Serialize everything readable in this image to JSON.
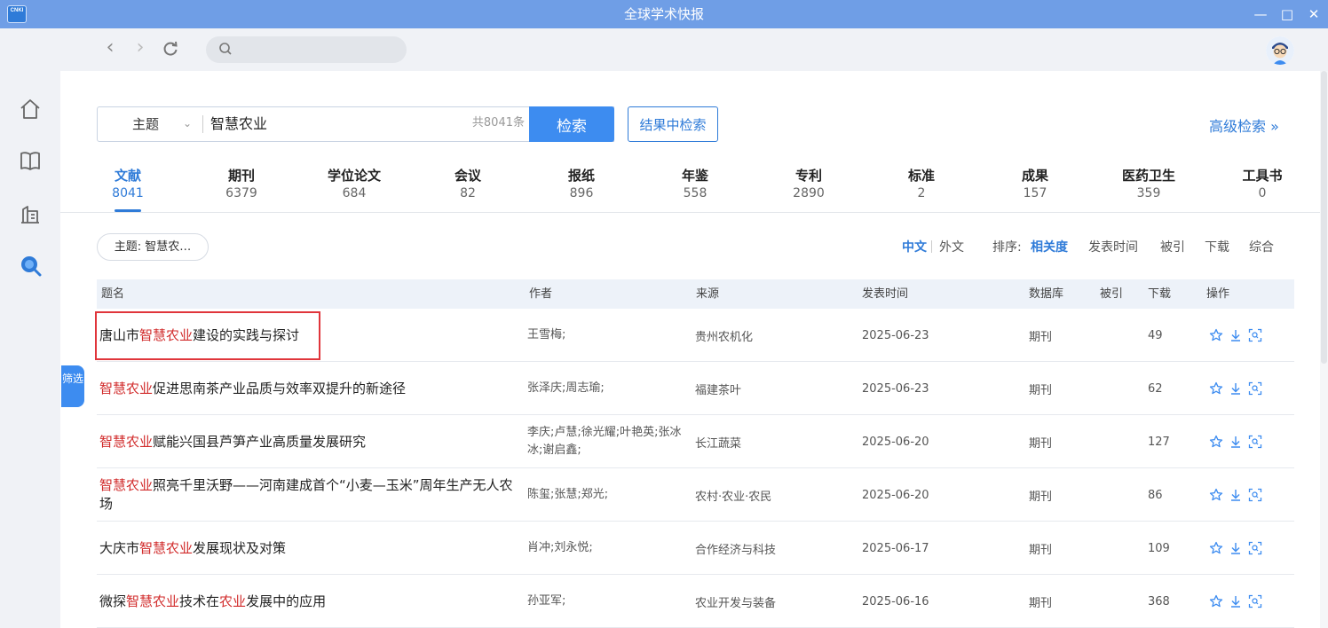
{
  "window": {
    "title": "全球学术快报",
    "logo_text": "CNKI"
  },
  "search": {
    "field": "主题",
    "keyword": "智慧农业",
    "total": "共8041条",
    "search_button": "检索",
    "within_button": "结果中检索",
    "advanced": "高级检索 »"
  },
  "tabs": [
    {
      "label": "文献",
      "count": "8041"
    },
    {
      "label": "期刊",
      "count": "6379"
    },
    {
      "label": "学位论文",
      "count": "684"
    },
    {
      "label": "会议",
      "count": "82"
    },
    {
      "label": "报纸",
      "count": "896"
    },
    {
      "label": "年鉴",
      "count": "558"
    },
    {
      "label": "专利",
      "count": "2890"
    },
    {
      "label": "标准",
      "count": "2"
    },
    {
      "label": "成果",
      "count": "157"
    },
    {
      "label": "医药卫生",
      "count": "359"
    },
    {
      "label": "工具书",
      "count": "0"
    }
  ],
  "filter": {
    "chip": "主题: 智慧农…",
    "side_tab": "筛选",
    "lang_zh": "中文",
    "lang_foreign": "外文",
    "sort_label": "排序:",
    "sort_options": [
      "相关度",
      "发表时间",
      "被引",
      "下载",
      "综合"
    ]
  },
  "table": {
    "headers": [
      "题名",
      "作者",
      "来源",
      "发表时间",
      "数据库",
      "被引",
      "下载",
      "操作"
    ],
    "rows": [
      {
        "title_pre": "唐山市",
        "title_hl": "智慧农业",
        "title_post": "建设的实践与探讨",
        "author": "王雪梅;",
        "source": "贵州农机化",
        "date": "2025-06-23",
        "db": "期刊",
        "cite": "",
        "download": "49"
      },
      {
        "title_pre": "",
        "title_hl": "智慧农业",
        "title_post": "促进思南茶产业品质与效率双提升的新途径",
        "author": "张泽庆;周志瑜;",
        "source": "福建茶叶",
        "date": "2025-06-23",
        "db": "期刊",
        "cite": "",
        "download": "62"
      },
      {
        "title_pre": "",
        "title_hl": "智慧农业",
        "title_post": "赋能兴国县芦笋产业高质量发展研究",
        "author": "李庆;卢慧;徐光耀;叶艳英;张冰冰;谢启鑫;",
        "source": "长江蔬菜",
        "date": "2025-06-20",
        "db": "期刊",
        "cite": "",
        "download": "127"
      },
      {
        "title_pre": "",
        "title_hl": "智慧农业",
        "title_post": "照亮千里沃野——河南建成首个“小麦—玉米”周年生产无人农场",
        "author": "陈玺;张慧;郑光;",
        "source": "农村·农业·农民",
        "date": "2025-06-20",
        "db": "期刊",
        "cite": "",
        "download": "86"
      },
      {
        "title_pre": "大庆市",
        "title_hl": "智慧农业",
        "title_post": "发展现状及对策",
        "author": "肖冲;刘永悦;",
        "source": "合作经济与科技",
        "date": "2025-06-17",
        "db": "期刊",
        "cite": "",
        "download": "109"
      },
      {
        "title_pre": "微探",
        "title_hl": "智慧农业",
        "title_post": "技术在",
        "title_hl2": "农业",
        "title_post2": "发展中的应用",
        "author": "孙亚军;",
        "source": "农业开发与装备",
        "date": "2025-06-16",
        "db": "期刊",
        "cite": "",
        "download": "368"
      }
    ]
  },
  "colors": {
    "accent": "#2f7bd8",
    "highlight": "#d12a2a",
    "titlebar": "#6f9ee6"
  }
}
